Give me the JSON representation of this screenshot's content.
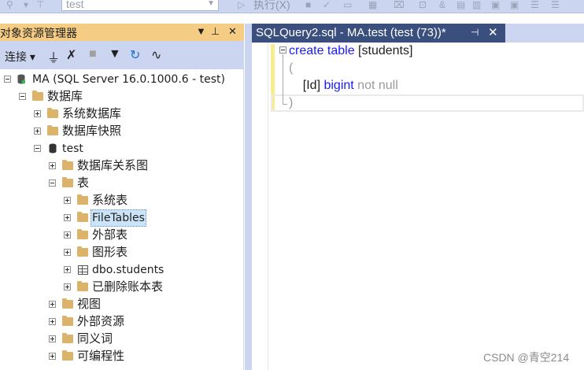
{
  "toolbar": {
    "database_value": "test",
    "execute_label": "执行(X)"
  },
  "object_explorer": {
    "title": "对象资源管理器",
    "connect_label": "连接",
    "tree": [
      {
        "label": "MA (SQL Server 16.0.1000.6 - test)",
        "icon": "server-icon",
        "expander": "minus",
        "level": 0
      },
      {
        "label": "数据库",
        "icon": "folder-icon",
        "expander": "minus",
        "level": 1
      },
      {
        "label": "系统数据库",
        "icon": "folder-icon",
        "expander": "plus",
        "level": 2
      },
      {
        "label": "数据库快照",
        "icon": "folder-icon",
        "expander": "plus",
        "level": 2
      },
      {
        "label": "test",
        "icon": "database-icon",
        "expander": "minus",
        "level": 2
      },
      {
        "label": "数据库关系图",
        "icon": "folder-icon",
        "expander": "plus",
        "level": 3
      },
      {
        "label": "表",
        "icon": "folder-icon",
        "expander": "minus",
        "level": 3
      },
      {
        "label": "系统表",
        "icon": "folder-icon",
        "expander": "plus",
        "level": 4
      },
      {
        "label": "FileTables",
        "icon": "folder-icon",
        "expander": "plus",
        "level": 4,
        "selected": true
      },
      {
        "label": "外部表",
        "icon": "folder-icon",
        "expander": "plus",
        "level": 4
      },
      {
        "label": "图形表",
        "icon": "folder-icon",
        "expander": "plus",
        "level": 4
      },
      {
        "label": "dbo.students",
        "icon": "table-icon",
        "expander": "plus",
        "level": 4
      },
      {
        "label": "已删除账本表",
        "icon": "folder-icon",
        "expander": "plus",
        "level": 4
      },
      {
        "label": "视图",
        "icon": "folder-icon",
        "expander": "plus",
        "level": 3
      },
      {
        "label": "外部资源",
        "icon": "folder-icon",
        "expander": "plus",
        "level": 3
      },
      {
        "label": "同义词",
        "icon": "folder-icon",
        "expander": "plus",
        "level": 3
      },
      {
        "label": "可编程性",
        "icon": "folder-icon",
        "expander": "plus",
        "level": 3
      }
    ]
  },
  "editor": {
    "tab_label": "SQLQuery2.sql - MA.test (test (73))*",
    "code": {
      "line1_kw": "create table",
      "line1_rest": " [students]",
      "line2": "(",
      "line3_ident": "    [Id] ",
      "line3_type": "bigint",
      "line3_rest": " not null",
      "line4": ")"
    }
  },
  "watermark": "CSDN @青空214"
}
